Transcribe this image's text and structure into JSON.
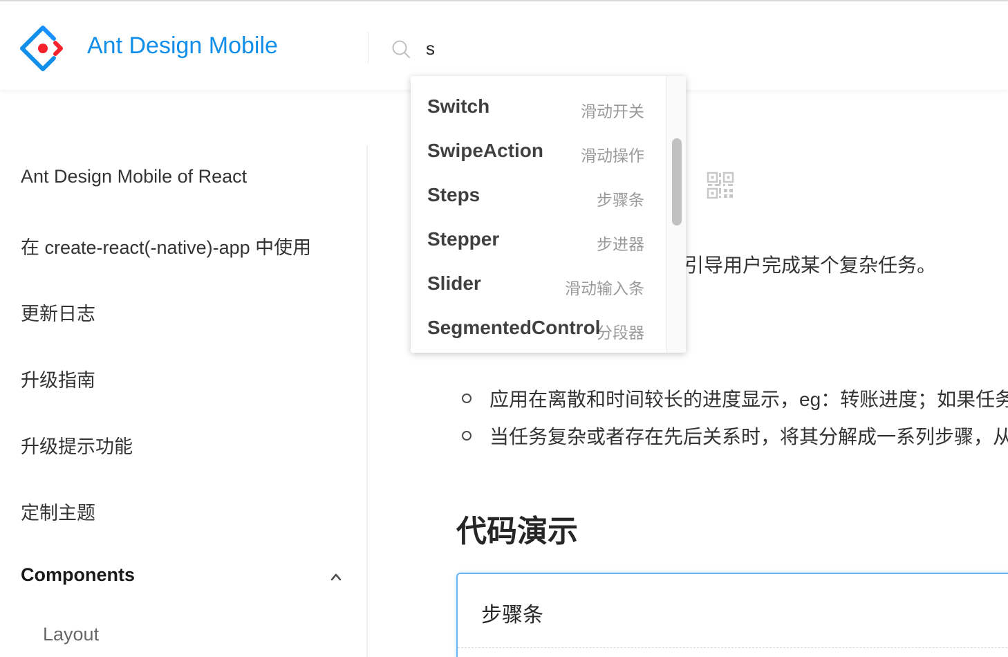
{
  "header": {
    "logo_text": "Ant Design Mobile",
    "search_value": "s",
    "colors": {
      "brand_blue": "#108ee9",
      "brand_red": "#f5222d"
    }
  },
  "sidebar": {
    "items": [
      {
        "label": "Ant Design Mobile of React"
      },
      {
        "label": "在 create-react(-native)-app 中使用"
      },
      {
        "label": "更新日志"
      },
      {
        "label": "升级指南"
      },
      {
        "label": "升级提示功能"
      },
      {
        "label": "定制主题"
      }
    ],
    "components_label": "Components",
    "sub_items": [
      {
        "label": "Layout"
      }
    ]
  },
  "search_dropdown": {
    "items": [
      {
        "name": "Switch",
        "desc": "滑动开关"
      },
      {
        "name": "SwipeAction",
        "desc": "滑动操作"
      },
      {
        "name": "Steps",
        "desc": "步骤条"
      },
      {
        "name": "Stepper",
        "desc": "步进器"
      },
      {
        "name": "Slider",
        "desc": "滑动输入条"
      },
      {
        "name": "SegmentedControl",
        "desc": "分段器"
      }
    ]
  },
  "content": {
    "description_fragment": "引导用户完成某个复杂任务。",
    "bullets": [
      "应用在离散和时间较长的进度显示，eg：转账进度；如果任务",
      "当任务复杂或者存在先后关系时，将其分解成一系列步骤，从"
    ],
    "demo_section_title": "代码演示",
    "demo_card_title": "步骤条"
  }
}
